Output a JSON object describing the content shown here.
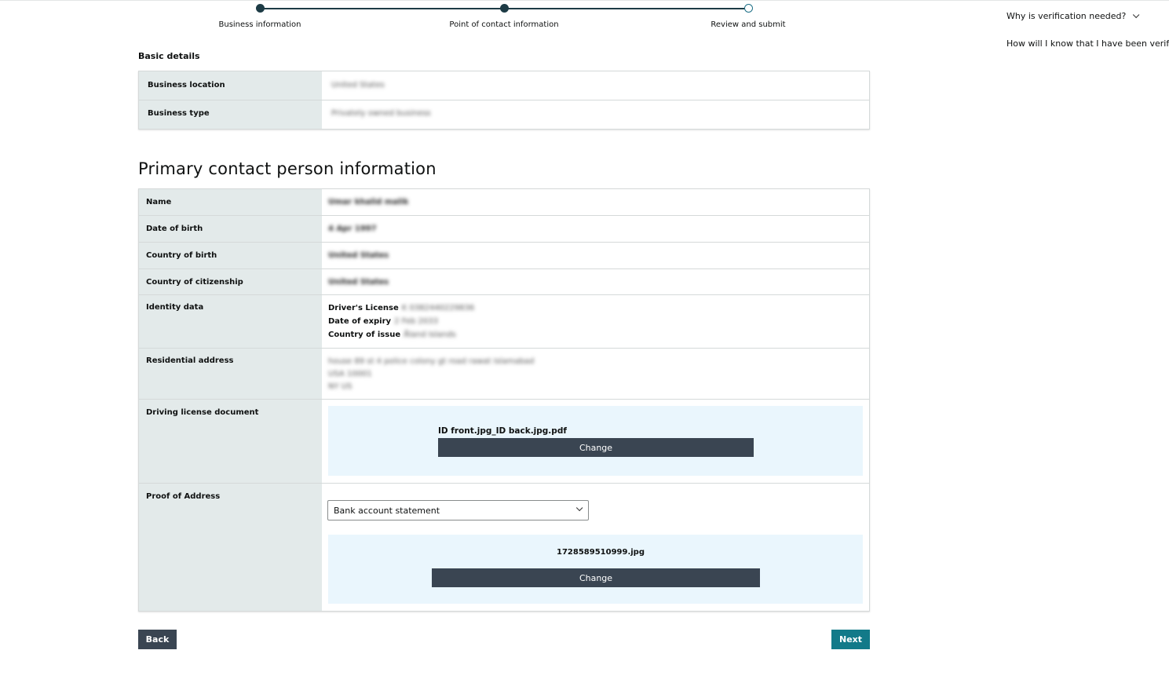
{
  "stepper": {
    "steps": [
      {
        "label": "Business information",
        "state": "complete"
      },
      {
        "label": "Point of contact information",
        "state": "current"
      },
      {
        "label": "Review and submit",
        "state": "pending"
      }
    ]
  },
  "help": {
    "why_verification": "Why is verification needed?",
    "how_verified": "How will I know that I have been verified"
  },
  "basic_details": {
    "heading": "Basic details",
    "rows": [
      {
        "label": "Business location",
        "value": "United States"
      },
      {
        "label": "Business type",
        "value": "Privately owned business"
      }
    ]
  },
  "primary_contact": {
    "heading": "Primary contact person information",
    "name_label": "Name",
    "name_value": "Umar khalid malik",
    "dob_label": "Date of birth",
    "dob_value": "4 Apr 1997",
    "country_birth_label": "Country of birth",
    "country_birth_value": "United States",
    "citizenship_label": "Country of citizenship",
    "citizenship_value": "United States",
    "identity_label": "Identity data",
    "identity": {
      "license_label": "Driver's License",
      "license_value": "K 0382440229836",
      "expiry_label": "Date of expiry",
      "expiry_value": "2 Feb 2033",
      "issue_label": "Country of issue",
      "issue_value": "Åland Islands"
    },
    "address_label": "Residential address",
    "address_lines": [
      "house 89 st 4 police colony gt road rawat Islamabad",
      "USA 10001",
      "NY US"
    ],
    "driving_doc_label": "Driving license document",
    "driving_doc_file": "ID front.jpg_ID back.jpg.pdf",
    "change_label": "Change",
    "proof_label": "Proof of Address",
    "proof_select": "Bank account statement",
    "proof_file": "1728589510999.jpg"
  },
  "nav": {
    "back": "Back",
    "next": "Next"
  },
  "colors": {
    "stepper": "#1d3b45",
    "label_bg": "#e3eaea",
    "upload_bg": "#eaf6fd",
    "dark_button": "#3a4552",
    "next_button": "#127a89"
  }
}
